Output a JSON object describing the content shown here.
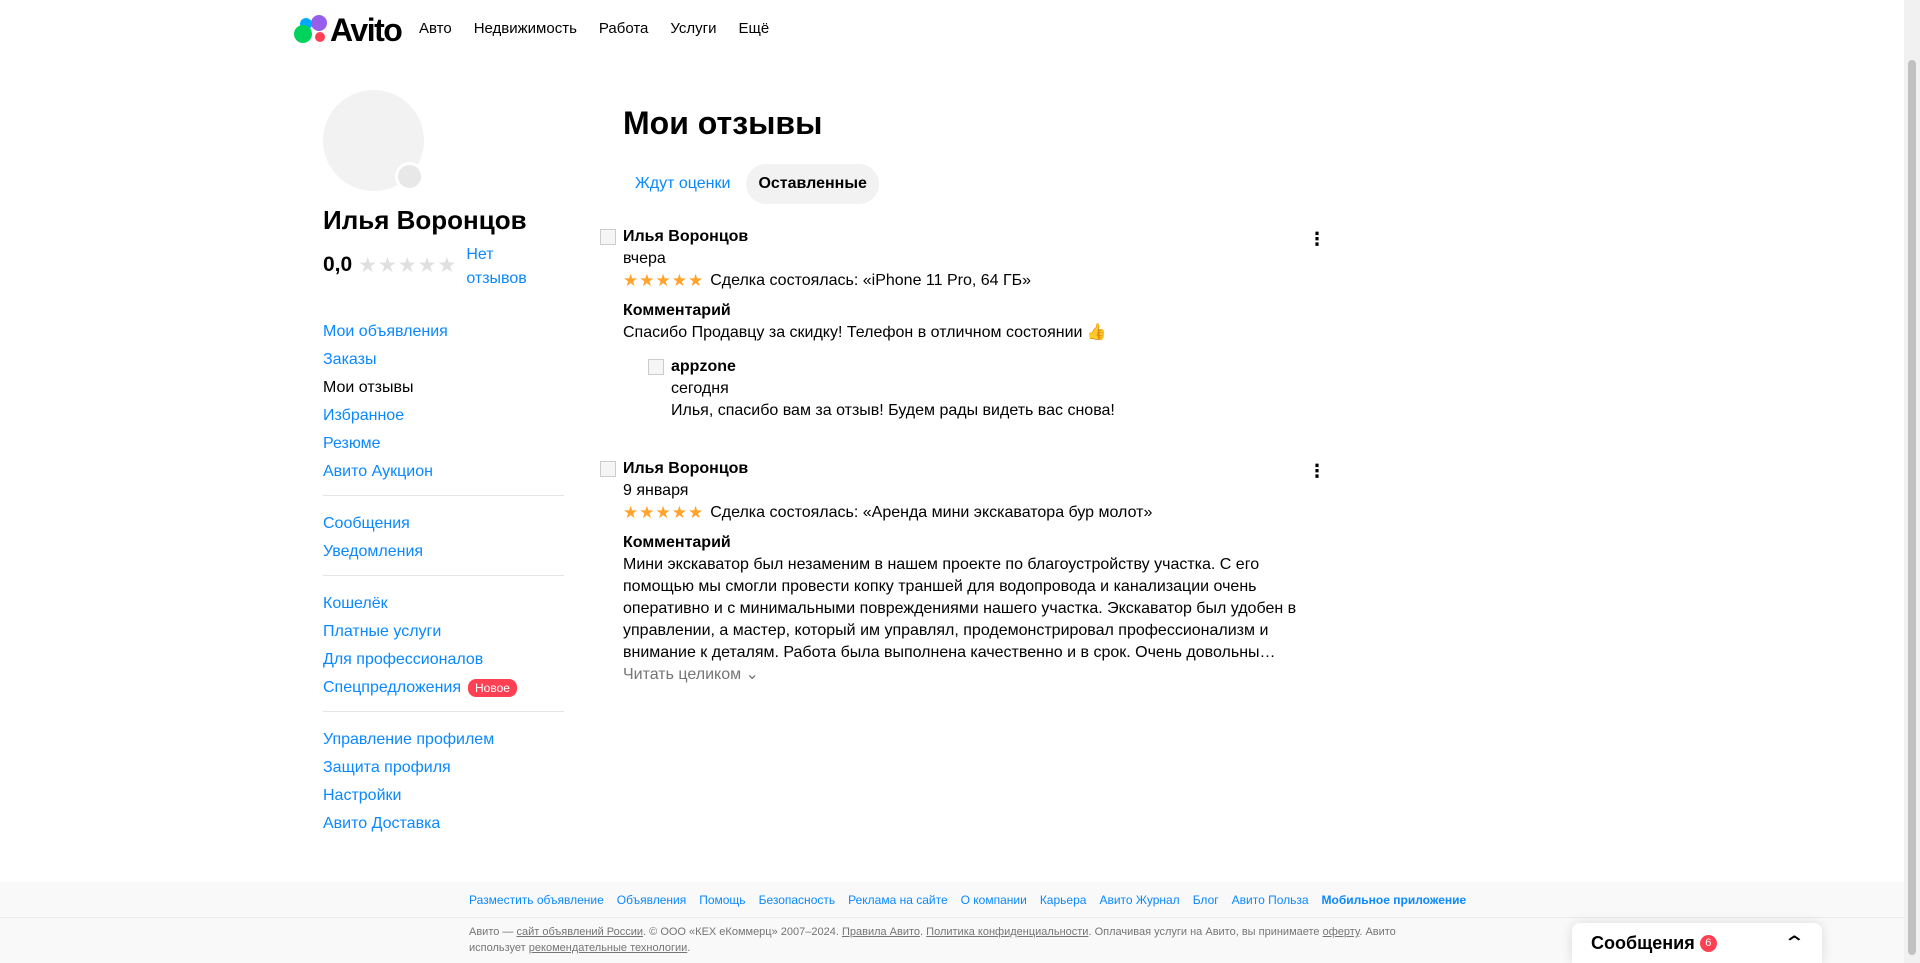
{
  "header": {
    "logo": "Avito",
    "nav": [
      "Авто",
      "Недвижимость",
      "Работа",
      "Услуги",
      "Ещё"
    ]
  },
  "profile": {
    "name": "Илья Воронцов",
    "rating": "0,0",
    "stars": "★★★★★",
    "no_reviews": "Нет отзывов"
  },
  "sidebar": {
    "groups": [
      [
        "Мои объявления",
        "Заказы",
        "Мои отзывы",
        "Избранное",
        "Резюме",
        "Авито Аукцион"
      ],
      [
        "Сообщения",
        "Уведомления"
      ],
      [
        "Кошелёк",
        "Платные услуги",
        "Для профессионалов",
        "Спецпредложения"
      ],
      [
        "Управление профилем",
        "Защита профиля",
        "Настройки",
        "Авито Доставка"
      ]
    ],
    "new_badge": "Новое",
    "active": "Мои отзывы"
  },
  "main": {
    "title": "Мои отзывы",
    "tabs": [
      "Ждут оценки",
      "Оставленные"
    ],
    "active_tab": "Оставленные",
    "reviews": [
      {
        "author": "Илья Воронцов",
        "date": "вчера",
        "stars": "★★★★★",
        "deal": "Сделка состоялась: «iPhone 11 Pro, 64 ГБ»",
        "comment_heading": "Комментарий",
        "comment": "Спасибо Продавцу за скидку! Телефон в отличном состоянии 👍",
        "reply": {
          "author": "appzone",
          "date": "сегодня",
          "text": "Илья, спасибо вам за отзыв! Будем рады видеть вас снова!"
        }
      },
      {
        "author": "Илья Воронцов",
        "date": "9 января",
        "stars": "★★★★★",
        "deal": "Сделка состоялась: «Аренда мини экскаватора бур молот»",
        "comment_heading": "Комментарий",
        "comment": "Мини экскаватор был незаменим в нашем проекте по благоустройству участка. С его помощью мы смогли провести копку траншей для водопровода и канализации очень оперативно и с минимальными повреждениями нашего участка. Экскаватор был удобен в управлении, а мастер, который им управлял, продемонстрировал профессионализм и внимание к деталям. Работа была выполнена качественно и в срок. Очень довольны…",
        "read_more": "Читать целиком ⌄"
      }
    ]
  },
  "footer": {
    "links": [
      "Разместить объявление",
      "Объявления",
      "Помощь",
      "Безопасность",
      "Реклама на сайте",
      "О компании",
      "Карьера",
      "Авито Журнал",
      "Блог",
      "Авито Польза",
      "Мобильное приложение"
    ],
    "legal_1": "Авито — ",
    "legal_link_1": "сайт объявлений России",
    "legal_2": ". © ООО «КЕХ еКоммерц» 2007–2024. ",
    "legal_link_2": "Правила Авито",
    "legal_3": ". ",
    "legal_link_3": "Политика конфиденциальности",
    "legal_4": ". Оплачивая услуги на Авито, вы принимаете ",
    "legal_link_4": "оферту",
    "legal_5": ". Авито использует ",
    "legal_link_5": "рекомендательные технологии",
    "legal_6": "."
  },
  "messenger": {
    "title": "Сообщения",
    "count": "6"
  },
  "colors": {
    "link": "#0a88ff",
    "star": "#ffa32b",
    "badge": "#ff4053"
  }
}
